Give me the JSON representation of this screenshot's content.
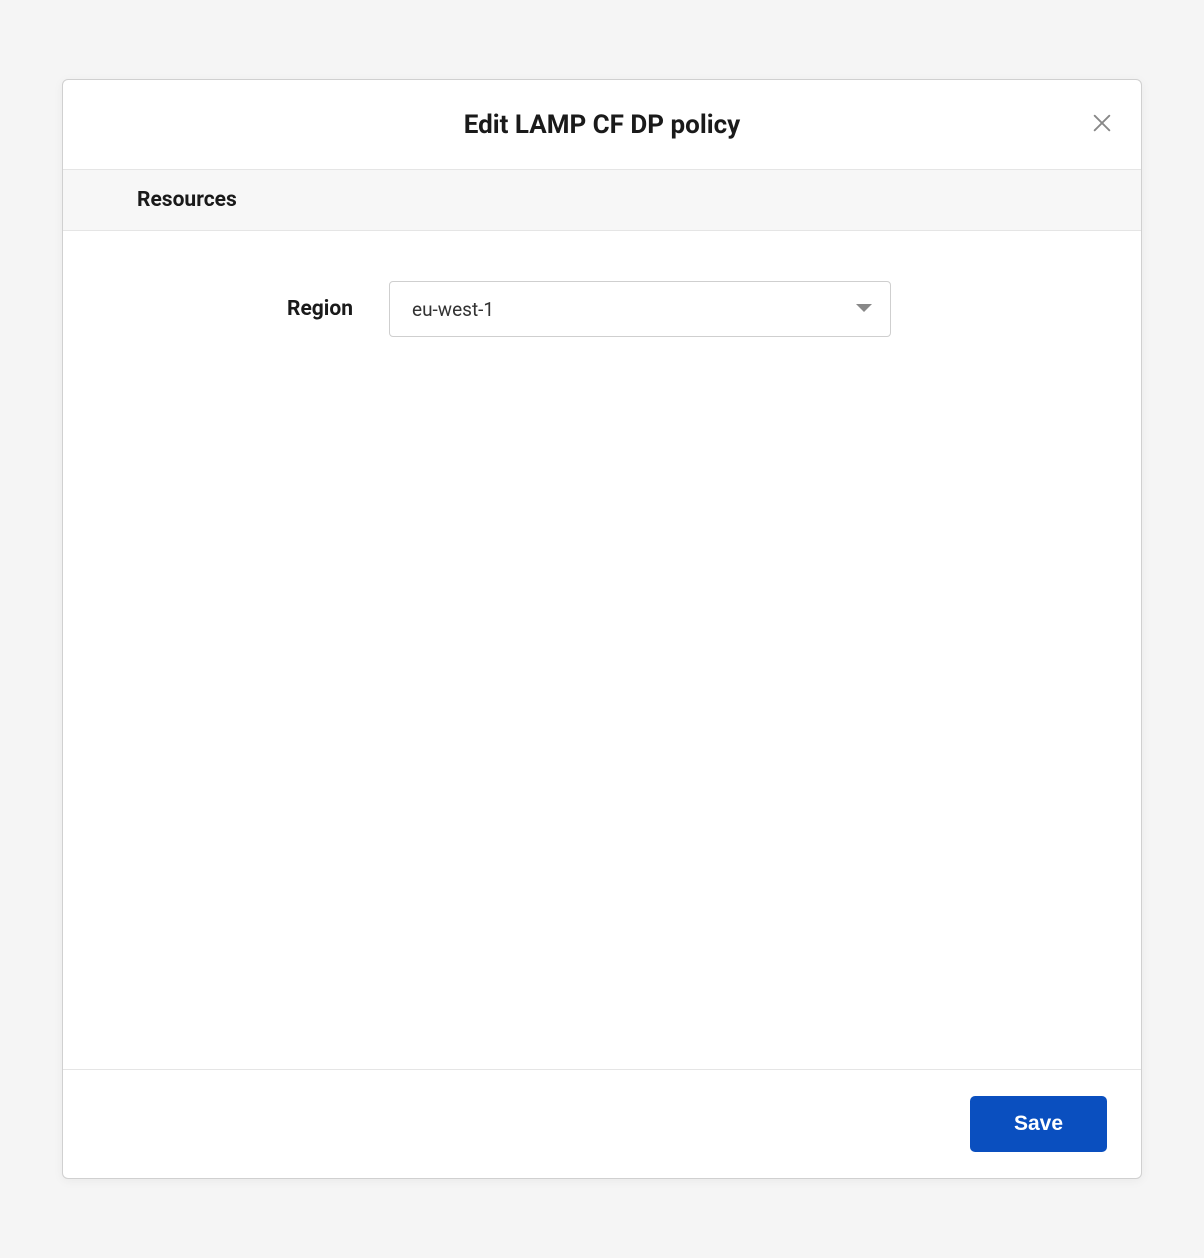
{
  "modal": {
    "title": "Edit LAMP CF DP policy",
    "section_header": "Resources",
    "region_label": "Region",
    "region_value": "eu-west-1",
    "save_label": "Save"
  }
}
